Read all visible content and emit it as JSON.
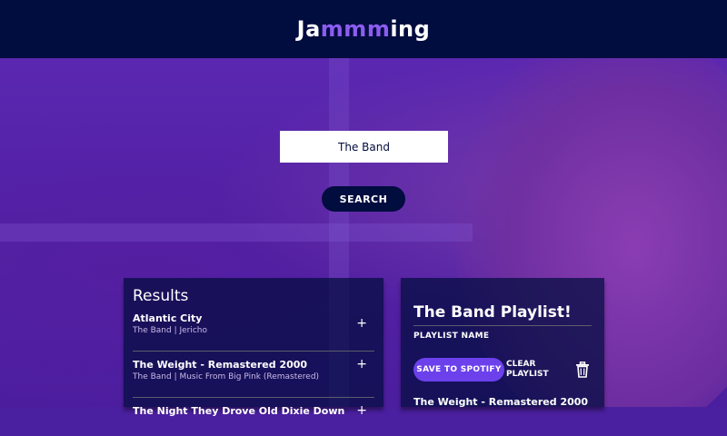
{
  "header": {
    "brand_prefix": "Ja",
    "brand_accent": "mmm",
    "brand_suffix": "ing"
  },
  "search": {
    "value": "The Band",
    "button_label": "SEARCH"
  },
  "results": {
    "title": "Results",
    "tracks": [
      {
        "name": "Atlantic City",
        "info": "The Band | Jericho",
        "add": "+"
      },
      {
        "name": "The Weight - Remastered 2000",
        "info": "The Band | Music From Big Pink (Remastered)",
        "add": "+"
      },
      {
        "name": "The Night They Drove Old Dixie Down",
        "info": "",
        "add": "+"
      }
    ]
  },
  "playlist": {
    "title": "The Band Playlist!",
    "name_label": "PLAYLIST NAME",
    "save_label": "SAVE TO SPOTIFY",
    "clear_label_1": "CLEAR",
    "clear_label_2": "PLAYLIST",
    "tracks": [
      {
        "name": "The Weight - Remastered 2000"
      }
    ]
  },
  "colors": {
    "header_bg": "#010c3f",
    "accent": "#8c5cf0",
    "save_button": "#6c41ec"
  },
  "icons": [
    "plus-icon",
    "trash-icon"
  ]
}
